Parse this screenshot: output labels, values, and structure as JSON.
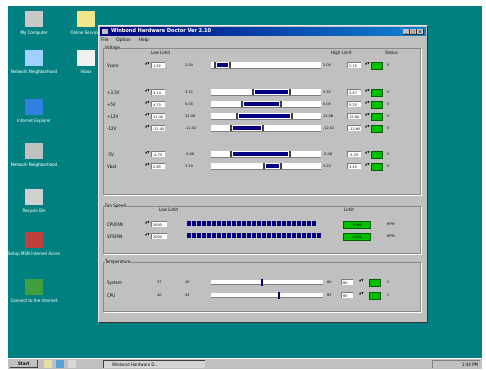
{
  "desktop": {
    "icons": [
      {
        "label": "My Computer",
        "icon": "my-computer-icon"
      },
      {
        "label": "Online Services",
        "icon": "folder-icon"
      },
      {
        "label": "Network Neighborhood",
        "icon": "network-neighborhood-icon"
      },
      {
        "label": "Inbox",
        "icon": "inbox-icon"
      },
      {
        "label": "Internet Explorer",
        "icon": "internet-explorer-icon"
      },
      {
        "label": "Network Neighborhood",
        "icon": "network-icon"
      },
      {
        "label": "Recycle Bin",
        "icon": "recycle-bin-icon"
      },
      {
        "label": "Setup MSN Internet Access",
        "icon": "msn-icon"
      },
      {
        "label": "Connect to the Internet",
        "icon": "connect-internet-icon"
      }
    ]
  },
  "window": {
    "title": "Winbond Hardware Doctor Ver 2.10",
    "menu": [
      "File",
      "Option",
      "Help"
    ]
  },
  "groups": {
    "voltage": "Voltage",
    "fan": "Fan Speed",
    "temperature": "Temperature"
  },
  "headers": {
    "low_limit": "Low Limit",
    "high_limit": "High Limit",
    "status": "Status",
    "limit": "Limit"
  },
  "voltage_rows": [
    {
      "label": "Vcore",
      "low": "1.52",
      "value": "2.00",
      "high": "2.15",
      "unit": "V"
    },
    {
      "label": "+3.3V",
      "low": "3.14",
      "value": "3.32",
      "high": "3.47",
      "unit": "V"
    },
    {
      "label": "+5V",
      "low": "4.75",
      "value": "5.05",
      "high": "5.25",
      "unit": "V"
    },
    {
      "label": "+12V",
      "low": "11.40",
      "value": "12.08",
      "high": "12.60",
      "unit": "V"
    },
    {
      "label": "-12V",
      "low": "-11.40",
      "value": "-12.02",
      "high": "-12.60",
      "unit": "V"
    },
    {
      "label": "-5V",
      "low": "-4.75",
      "value": "-5.08",
      "high": "-5.25",
      "unit": "V"
    },
    {
      "label": "Vbat",
      "low": "2.85",
      "value": "3.20",
      "high": "3.45",
      "unit": "V"
    }
  ],
  "fan_rows": [
    {
      "label": "CPUFAN",
      "limit": "2000",
      "reading": "4166",
      "unit": "RPM"
    },
    {
      "label": "SYSFAN",
      "limit": "2000",
      "reading": "4326",
      "unit": "RPM"
    }
  ],
  "temp_rows": [
    {
      "label": "System",
      "low": "37",
      "value": "40",
      "high": "60",
      "unit": "C"
    },
    {
      "label": "CPU",
      "low": "40",
      "value": "45",
      "high": "65",
      "unit": "C"
    }
  ],
  "levels": {
    "voltage": [
      {
        "a": 0.05,
        "b": 0.15
      },
      {
        "a": 0.4,
        "b": 0.7
      },
      {
        "a": 0.3,
        "b": 0.62
      },
      {
        "a": 0.25,
        "b": 0.72
      },
      {
        "a": 0.2,
        "b": 0.45
      },
      {
        "a": 0.2,
        "b": 0.7
      },
      {
        "a": 0.5,
        "b": 0.62
      }
    ],
    "fan": [
      0.8,
      0.85
    ],
    "temp": [
      0.45,
      0.6
    ]
  },
  "colors": {
    "desktop": "#008080",
    "bar": "#000080",
    "status_ok": "#00c000"
  },
  "taskbar": {
    "start": "Start",
    "task": "Winbond Hardware D...",
    "clock": "1:44 PM"
  }
}
